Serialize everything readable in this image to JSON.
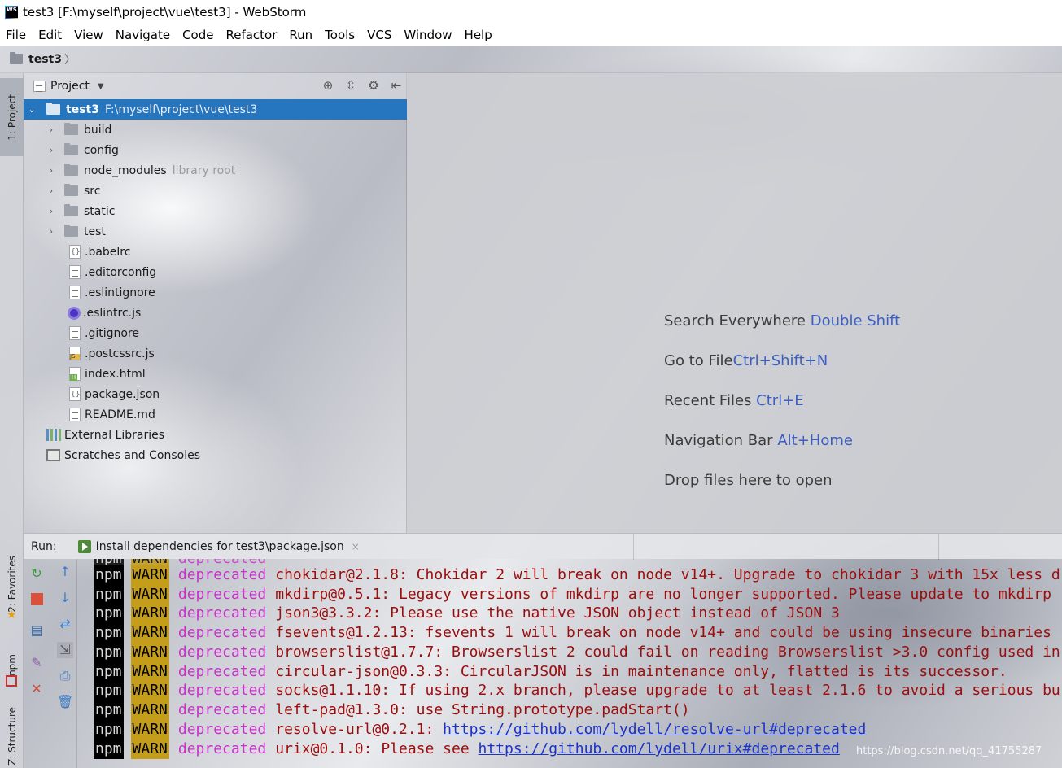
{
  "window": {
    "title": "test3 [F:\\myself\\project\\vue\\test3] - WebStorm",
    "app_icon": "webstorm-logo-icon"
  },
  "menu": [
    "File",
    "Edit",
    "View",
    "Navigate",
    "Code",
    "Refactor",
    "Run",
    "Tools",
    "VCS",
    "Window",
    "Help"
  ],
  "navbar": {
    "crumb": "test3",
    "separator": "〉"
  },
  "left_strip": {
    "tabs": [
      "1: Project",
      "2: Favorites",
      "npm",
      "Z: Structure"
    ]
  },
  "project": {
    "header": "Project",
    "root": {
      "name": "test3",
      "path": "F:\\myself\\project\\vue\\test3"
    },
    "folders": [
      {
        "name": "build",
        "hint": ""
      },
      {
        "name": "config",
        "hint": ""
      },
      {
        "name": "node_modules",
        "hint": "library root"
      },
      {
        "name": "src",
        "hint": ""
      },
      {
        "name": "static",
        "hint": ""
      },
      {
        "name": "test",
        "hint": ""
      }
    ],
    "files": [
      {
        "name": ".babelrc",
        "icon": "json-file-icon"
      },
      {
        "name": ".editorconfig",
        "icon": "text-file-icon"
      },
      {
        "name": ".eslintignore",
        "icon": "text-file-icon"
      },
      {
        "name": ".eslintrc.js",
        "icon": "eslint-icon"
      },
      {
        "name": ".gitignore",
        "icon": "text-file-icon"
      },
      {
        "name": ".postcssrc.js",
        "icon": "js-file-icon"
      },
      {
        "name": "index.html",
        "icon": "html-file-icon"
      },
      {
        "name": "package.json",
        "icon": "json-file-icon"
      },
      {
        "name": "README.md",
        "icon": "text-file-icon"
      }
    ],
    "extras": [
      "External Libraries",
      "Scratches and Consoles"
    ]
  },
  "editor_tips": [
    {
      "text": "Search Everywhere",
      "key": "Double Shift"
    },
    {
      "text": "Go to File",
      "key": "Ctrl+Shift+N"
    },
    {
      "text": "Recent Files",
      "key": "Ctrl+E"
    },
    {
      "text": "Navigation Bar",
      "key": "Alt+Home"
    },
    {
      "text": "Drop files here to open",
      "key": ""
    }
  ],
  "run": {
    "label": "Run:",
    "tab": "Install dependencies for test3\\package.json",
    "close": "×"
  },
  "console": {
    "prefix": "npm",
    "level": "WARN",
    "tag": "deprecated",
    "lines": [
      {
        "pkg": "chokidar@2.1.8:",
        "msg": "Chokidar 2 will break on node v14+. Upgrade to chokidar 3 with 15x less d",
        "link": ""
      },
      {
        "pkg": "mkdirp@0.5.1:",
        "msg": "Legacy versions of mkdirp are no longer supported. Please update to mkdirp",
        "link": ""
      },
      {
        "pkg": "json3@3.3.2:",
        "msg": "Please use the native JSON object instead of JSON 3",
        "link": ""
      },
      {
        "pkg": "fsevents@1.2.13:",
        "msg": "fsevents 1 will break on node v14+ and could be using insecure binaries",
        "link": ""
      },
      {
        "pkg": "browserslist@1.7.7:",
        "msg": "Browserslist 2 could fail on reading Browserslist >3.0 config used in",
        "link": ""
      },
      {
        "pkg": "circular-json@0.3.3:",
        "msg": "CircularJSON is in maintenance only, flatted is its successor.",
        "link": ""
      },
      {
        "pkg": "socks@1.1.10:",
        "msg": "If using 2.x branch, please upgrade to at least 2.1.6 to avoid a serious bu",
        "link": ""
      },
      {
        "pkg": "left-pad@1.3.0:",
        "msg": "use String.prototype.padStart()",
        "link": ""
      },
      {
        "pkg": "resolve-url@0.2.1:",
        "msg": "",
        "link": "https://github.com/lydell/resolve-url#deprecated"
      },
      {
        "pkg": "urix@0.1.0:",
        "msg": "Please see",
        "link": "https://github.com/lydell/urix#deprecated"
      }
    ]
  },
  "watermark": "https://blog.csdn.net/qq_41755287"
}
